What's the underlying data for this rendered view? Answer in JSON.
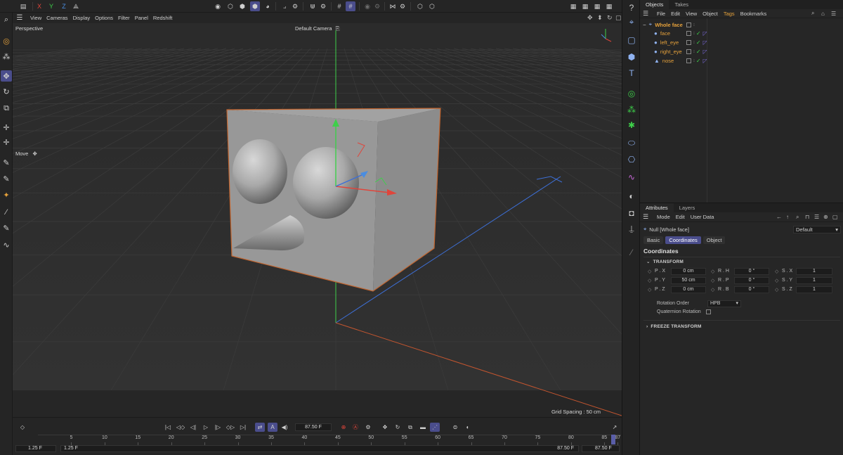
{
  "toolbar": {
    "axis_x": "X",
    "axis_y": "Y",
    "axis_z": "Z",
    "colors": {
      "x": "#e0453b",
      "y": "#3ecf4a",
      "z": "#4a8de0",
      "accent": "#4a4d8c",
      "orange": "#e5a13b"
    }
  },
  "viewport_menu": {
    "items": [
      "View",
      "Cameras",
      "Display",
      "Options",
      "Filter",
      "Panel",
      "Redshift"
    ]
  },
  "viewport": {
    "view_name": "Perspective",
    "camera": "Default Camera",
    "camera_icon": "camera-icon",
    "tool_label": "Move",
    "grid_spacing": "Grid Spacing : 50 cm"
  },
  "objects_panel": {
    "tabs": [
      "Objects",
      "Takes"
    ],
    "menu": [
      "File",
      "Edit",
      "View",
      "Object",
      "Tags",
      "Bookmarks"
    ],
    "items": [
      {
        "name": "Whole face",
        "icon": "null-object-icon"
      },
      {
        "name": "face",
        "icon": "sphere-icon"
      },
      {
        "name": "left_eye",
        "icon": "sphere-icon"
      },
      {
        "name": "right_eye",
        "icon": "sphere-icon"
      },
      {
        "name": "nose",
        "icon": "cone-icon"
      }
    ]
  },
  "attributes_panel": {
    "tabs": [
      "Attributes",
      "Layers"
    ],
    "menu": [
      "Mode",
      "Edit",
      "User Data"
    ],
    "object_label": "Null [Whole face]",
    "mode_value": "Default",
    "sub_tabs": [
      "Basic",
      "Coordinates",
      "Object"
    ],
    "active_sub_tab": "Coordinates",
    "heading": "Coordinates",
    "group_transform": "TRANSFORM",
    "group_freeze": "FREEZE TRANSFORM",
    "position": {
      "x_label": "P . X",
      "y_label": "P . Y",
      "z_label": "P . Z",
      "x": "0 cm",
      "y": "50 cm",
      "z": "0 cm"
    },
    "rotation": {
      "h_label": "R . H",
      "p_label": "R . P",
      "b_label": "R . B",
      "h": "0 °",
      "p": "0 °",
      "b": "0 °"
    },
    "scale": {
      "x_label": "S . X",
      "y_label": "S . Y",
      "z_label": "S . Z",
      "x": "1",
      "y": "1",
      "z": "1"
    },
    "rotation_order_label": "Rotation Order",
    "rotation_order_value": "HPB",
    "quaternion_label": "Quaternion Rotation"
  },
  "timeline": {
    "current_frame": "87.50 F",
    "ticks": [
      "5",
      "10",
      "15",
      "20",
      "25",
      "30",
      "35",
      "40",
      "45",
      "50",
      "55",
      "60",
      "65",
      "70",
      "75",
      "80",
      "85",
      "87"
    ],
    "range_start_a": "1.25 F",
    "range_start_b": "1.25 F",
    "range_end_a": "87.50 F",
    "range_end_b": "87.50 F"
  }
}
